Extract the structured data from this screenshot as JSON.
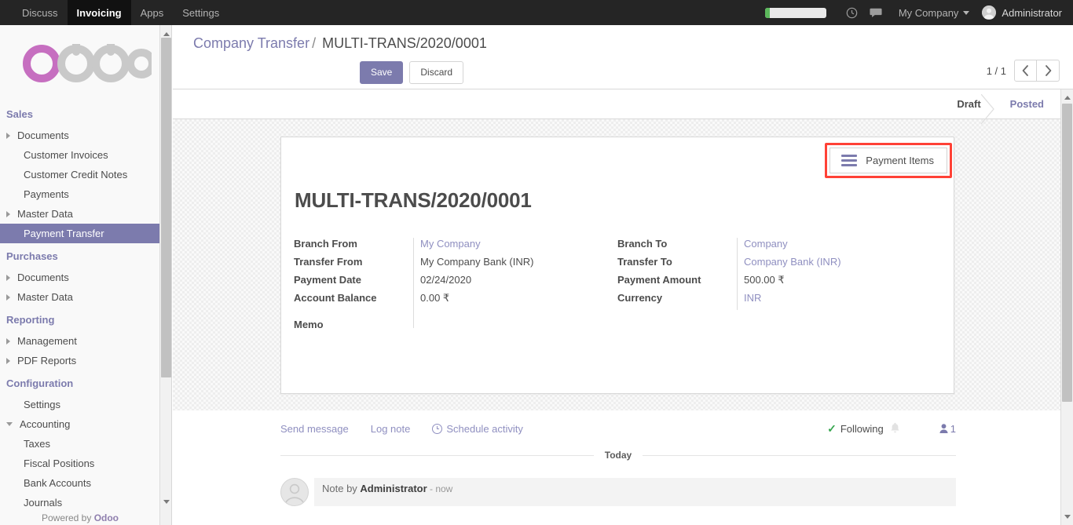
{
  "topbar": {
    "menus": [
      {
        "label": "Discuss",
        "active": false
      },
      {
        "label": "Invoicing",
        "active": true
      },
      {
        "label": "Apps",
        "active": false
      },
      {
        "label": "Settings",
        "active": false
      }
    ],
    "company": "My Company",
    "user": "Administrator",
    "icons": [
      "clock-icon",
      "chat-icon"
    ],
    "accent_green": "#5cb85c"
  },
  "sidebar": {
    "logo": "odoo",
    "logo_accent": "#b85fb3",
    "sections": [
      {
        "title": "Sales",
        "items": [
          {
            "label": "Documents",
            "type": "toggle-closed",
            "selected": false
          },
          {
            "label": "Customer Invoices",
            "type": "child",
            "selected": false
          },
          {
            "label": "Customer Credit Notes",
            "type": "child",
            "selected": false
          },
          {
            "label": "Payments",
            "type": "child",
            "selected": false
          },
          {
            "label": "Master Data",
            "type": "toggle-closed",
            "selected": false
          },
          {
            "label": "Payment Transfer",
            "type": "child",
            "selected": true
          }
        ]
      },
      {
        "title": "Purchases",
        "items": [
          {
            "label": "Documents",
            "type": "toggle-closed",
            "selected": false
          },
          {
            "label": "Master Data",
            "type": "toggle-closed",
            "selected": false
          }
        ]
      },
      {
        "title": "Reporting",
        "items": [
          {
            "label": "Management",
            "type": "toggle-closed",
            "selected": false
          },
          {
            "label": "PDF Reports",
            "type": "toggle-closed",
            "selected": false
          }
        ]
      },
      {
        "title": "Configuration",
        "items": [
          {
            "label": "Settings",
            "type": "child",
            "selected": false
          },
          {
            "label": "Accounting",
            "type": "toggle-open",
            "selected": false
          },
          {
            "label": "Taxes",
            "type": "child",
            "selected": false
          },
          {
            "label": "Fiscal Positions",
            "type": "child",
            "selected": false
          },
          {
            "label": "Bank Accounts",
            "type": "child",
            "selected": false
          },
          {
            "label": "Journals",
            "type": "child",
            "selected": false
          }
        ]
      }
    ],
    "powered_prefix": "Powered by ",
    "powered_brand": "Odoo"
  },
  "control_panel": {
    "breadcrumb_parent": "Company Transfer",
    "breadcrumb_sep": "/",
    "breadcrumb_current": "MULTI-TRANS/2020/0001",
    "save_label": "Save",
    "discard_label": "Discard",
    "pager_counter": "1 / 1",
    "prev_icon": "chevron-left-icon",
    "next_icon": "chevron-right-icon"
  },
  "statusbar": {
    "states": [
      {
        "label": "Draft",
        "current": true
      },
      {
        "label": "Posted",
        "current": false
      }
    ]
  },
  "form": {
    "smart_button": {
      "label": "Payment Items",
      "icon": "bars-icon",
      "highlight_color": "#ff4136"
    },
    "title": "MULTI-TRANS/2020/0001",
    "left_fields": [
      {
        "label": "Branch From",
        "value": "My Company",
        "is_link": true
      },
      {
        "label": "Transfer From",
        "value": "My Company Bank (INR)",
        "is_link": false
      },
      {
        "label": "Payment Date",
        "value": "02/24/2020",
        "is_link": false
      },
      {
        "label": "Account Balance",
        "value": "0.00 ₹",
        "is_link": false
      },
      {
        "label": "Memo",
        "value": "",
        "is_link": false
      }
    ],
    "right_fields": [
      {
        "label": "Branch To",
        "value": "Company",
        "is_link": true
      },
      {
        "label": "Transfer To",
        "value": "Company Bank (INR)",
        "is_link": true
      },
      {
        "label": "Payment Amount",
        "value": "500.00 ₹",
        "is_link": false
      },
      {
        "label": "Currency",
        "value": "INR",
        "is_link": true
      }
    ]
  },
  "chatter": {
    "send_message": "Send message",
    "log_note": "Log note",
    "schedule_activity": "Schedule activity",
    "following_label": "Following",
    "followers_count": "1",
    "day_separator": "Today",
    "message": {
      "prefix": "Note by ",
      "author": "Administrator",
      "time": " - now"
    }
  }
}
